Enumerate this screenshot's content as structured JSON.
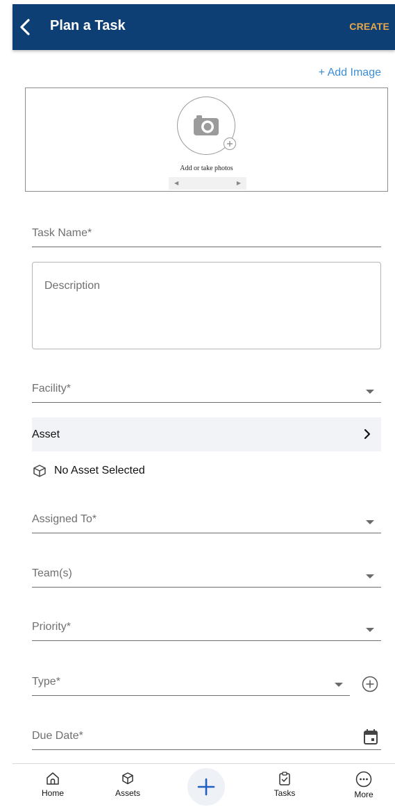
{
  "header": {
    "title": "Plan a Task",
    "create_label": "CREATE"
  },
  "photos": {
    "add_image_label": "+ Add Image",
    "caption": "Add or take photos"
  },
  "form": {
    "task_name_placeholder": "Task Name*",
    "description_placeholder": "Description",
    "facility_placeholder": "Facility*",
    "asset_label": "Asset",
    "no_asset_text": "No Asset Selected",
    "assigned_to_placeholder": "Assigned To*",
    "teams_placeholder": "Team(s)",
    "priority_placeholder": "Priority*",
    "type_placeholder": "Type*",
    "due_date_placeholder": "Due Date*"
  },
  "bottom_nav": {
    "items": [
      {
        "label": "Home",
        "icon": "home-icon"
      },
      {
        "label": "Assets",
        "icon": "cube-icon"
      },
      {
        "label": "Tasks",
        "icon": "clipboard-check-icon"
      },
      {
        "label": "More",
        "icon": "more-dots-icon"
      }
    ],
    "fab_icon": "plus-icon"
  },
  "colors": {
    "header_bg": "#0e3f74",
    "create_text": "#e8a84a",
    "link": "#3b8ed6",
    "fab_plus": "#1f5fbf"
  }
}
